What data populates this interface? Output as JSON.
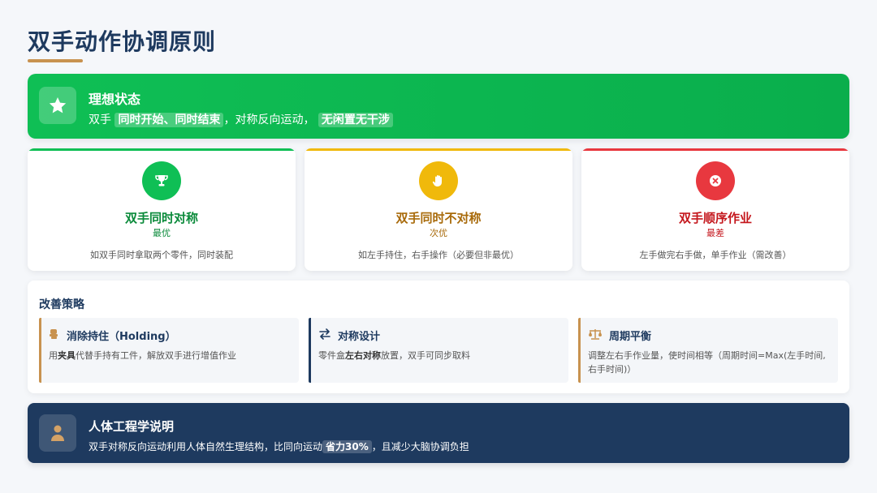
{
  "page": {
    "title": "双手动作协调原则"
  },
  "ideal": {
    "title": "理想状态",
    "text_prefix": "双手",
    "highlight1": "同时开始、同时结束",
    "text_mid": "，对称反向运动，",
    "highlight2": "无闲置无干涉",
    "icon": "star-icon"
  },
  "cards": [
    {
      "title": "双手同时对称",
      "rank": "最优",
      "desc": "如双手同时拿取两个零件，同时装配",
      "color": "#0fbf55",
      "title_color": "#0a8a3a",
      "icon": "trophy-icon"
    },
    {
      "title": "双手同时不对称",
      "rank": "次优",
      "desc": "如左手持住，右手操作（必要但非最优）",
      "color": "#f0b90b",
      "title_color": "#a86a0a",
      "icon": "hand-icon"
    },
    {
      "title": "双手顺序作业",
      "rank": "最差",
      "desc": "左手做完右手做，单手作业（需改善）",
      "color": "#e8383f",
      "title_color": "#c4161c",
      "icon": "close-circle-icon"
    }
  ],
  "strategy": {
    "title": "改善策略",
    "items": [
      {
        "title": "消除持住（Holding）",
        "pre": "用",
        "bold": "夹具",
        "post": "代替手持有工件，解放双手进行增值作业",
        "color": "#c8924f",
        "icon": "thumb-icon"
      },
      {
        "title": "对称设计",
        "pre": "零件盒",
        "bold": "左右对称",
        "post": "放置，双手可同步取料",
        "color": "#1e3a5f",
        "icon": "swap-arrows-icon"
      },
      {
        "title": "周期平衡",
        "pre": "调整左右手作业量，使时间相等（周期时间=Max(左手时间,右手时间)）",
        "bold": "",
        "post": "",
        "color": "#c8924f",
        "icon": "balance-icon"
      }
    ]
  },
  "ergo": {
    "title": "人体工程学说明",
    "text_prefix": "双手对称反向运动利用人体自然生理结构，比同向运动",
    "highlight": "省力30%",
    "text_suffix": "，且减少大脑协调负担",
    "icon": "person-icon"
  }
}
